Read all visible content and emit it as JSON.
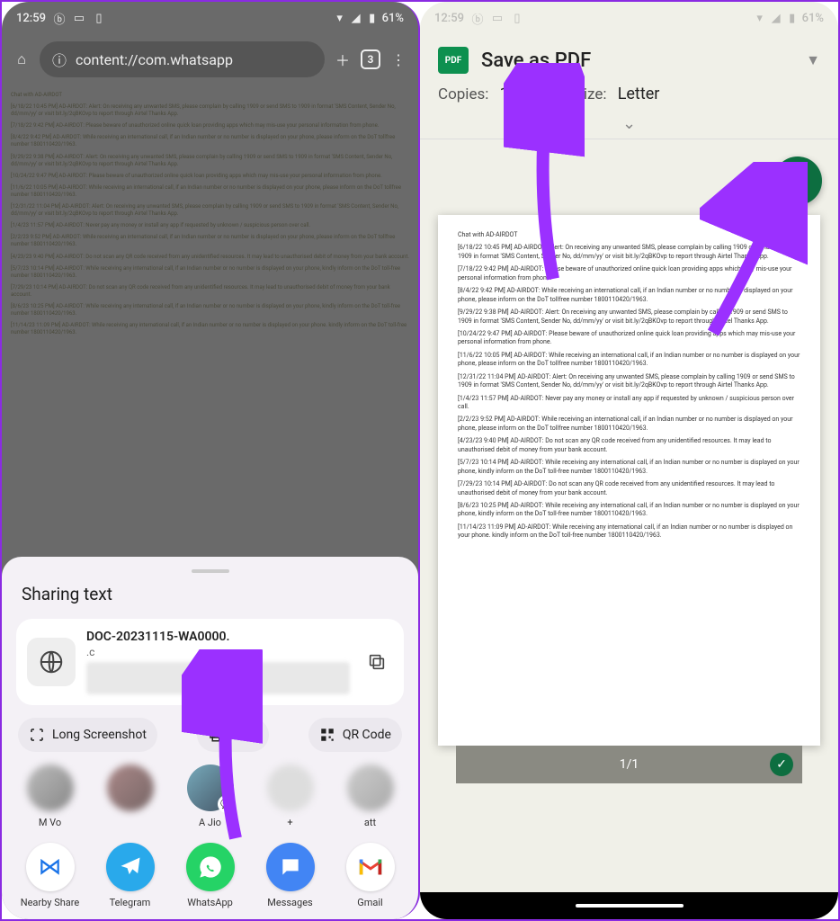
{
  "left": {
    "status": {
      "time": "12:59",
      "battery": "61%"
    },
    "url": "content://com.whatsapp",
    "tab_count": "3",
    "chat_title": "Chat with AD-AIRDOT",
    "chat_lines": [
      "[6/18/22 10:45 PM] AD-AIRDOT: Alert: On receiving any unwanted SMS, please complain by calling 1909 or send SMS to 1909 in format 'SMS Content, Sender No, dd/mm/yy' or visit bit.ly/2qBKOvp to report through Airtel Thanks App.",
      "[7/18/22 9:42 PM] AD-AIRDOT: Please beware of unauthorized online quick loan providing apps which may mis-use your personal information from phone.",
      "[8/4/22 9:42 PM] AD-AIRDOT: While receiving an international call, if an Indian number or no number is displayed on your phone, please inform on the DoT tollfree number 1800110420/1963.",
      "[9/29/22 9:38 PM] AD-AIRDOT: Alert: On receiving any unwanted SMS, please complain by calling 1909 or send SMS to 1909 in format 'SMS Content, Sender No, dd/mm/yy' or visit bit.ly/2qBKOvp to report through Airtel Thanks App.",
      "[10/24/22 9:47 PM] AD-AIRDOT: Please beware of unauthorized online quick loan providing apps which may mis-use your personal information from phone.",
      "[11/6/22 10:05 PM] AD-AIRDOT: While receiving an international call, if an Indian number or no number is displayed on your phone, please inform on the DoT tollfree number 1800110420/1963.",
      "[12/31/22 11:04 PM] AD-AIRDOT: Alert: On receiving any unwanted SMS, please complain by calling 1909 or send SMS to 1909 in format 'SMS Content, Sender No, dd/mm/yy' or visit bit.ly/2qBKOvp to report through Airtel Thanks App.",
      "[1/4/23 11:57 PM] AD-AIRDOT: Never pay any money or install any app if requested by unknown / suspicious person over call.",
      "[2/2/23 9:52 PM] AD-AIRDOT: While receiving an international call, if an Indian number or no number is displayed on your phone, please inform on the DoT tollfree number 1800110420/1963.",
      "[4/23/23 9:40 PM] AD-AIRDOT: Do not scan any QR code received from any unidentified resources. It may lead to unauthorised debit of money from your bank account.",
      "[5/7/23 10:14 PM] AD-AIRDOT: While receiving any international call, if an Indian number or no number is displayed on your phone, kindly inform on the DoT toll-free number 1800110420/1963.",
      "[7/29/23 10:14 PM] AD-AIRDOT: Do not scan any QR code received from any unidentified resources. It may lead to unauthorised debit of money from your bank account.",
      "[8/6/23 10:25 PM] AD-AIRDOT: While receiving any international call, if an Indian number or no number is displayed on your phone, kindly inform on the DoT toll-free number 1800110420/1963.",
      "[11/14/23 11:09 PM] AD-AIRDOT: While receiving any international call, if an Indian number or no number is displayed on your phone. kindly inform on the DoT toll-free number 1800110420/1963."
    ],
    "sheet": {
      "title": "Sharing text",
      "doc": {
        "name": "DOC-20231115-WA0000.",
        "sub": ".c",
        "tail": "·c"
      },
      "actions": {
        "long": "Long Screenshot",
        "print": "Print",
        "qr": "QR Code"
      },
      "contacts": [
        "M Vo",
        "",
        "A Jio",
        "+",
        "att"
      ],
      "apps": {
        "nearby": "Nearby Share",
        "telegram": "Telegram",
        "whatsapp": "WhatsApp",
        "messages": "Messages",
        "gmail": "Gmail"
      }
    }
  },
  "right": {
    "status": {
      "time": "12:59",
      "battery": "61%"
    },
    "destination": "Save as PDF",
    "copies_label": "Copies:",
    "copies_val": "1",
    "paper_label": "Paper size:",
    "paper_val": "Letter",
    "page_counter": "1/1",
    "chat_title": "Chat with AD-AIRDOT",
    "chat_lines": [
      "[6/18/22 10:45 PM] AD-AIRDOT: Alert: On receiving any unwanted SMS, please complain by calling 1909 or send SMS to 1909 in format 'SMS Content, Sender No, dd/mm/yy' or visit bit.ly/2qBKOvp to report through Airtel Thanks App.",
      "[7/18/22 9:42 PM] AD-AIRDOT: Please beware of unauthorized online quick loan providing apps which may mis-use your personal information from phone.",
      "[8/4/22 9:42 PM] AD-AIRDOT: While receiving an international call, if an Indian number or no number is displayed on your phone, please inform on the DoT tollfree number 1800110420/1963.",
      "[9/29/22 9:38 PM] AD-AIRDOT: Alert: On receiving any unwanted SMS, please complain by calling 1909 or send SMS to 1909 in format 'SMS Content, Sender No, dd/mm/yy' or visit bit.ly/2qBKOvp to report through Airtel Thanks App.",
      "[10/24/22 9:47 PM] AD-AIRDOT: Please beware of unauthorized online quick loan providing apps which may mis-use your personal information from phone.",
      "[11/6/22 10:05 PM] AD-AIRDOT: While receiving an international call, if an Indian number or no number is displayed on your phone, please inform on the DoT tollfree number 1800110420/1963.",
      "[12/31/22 11:04 PM] AD-AIRDOT: Alert: On receiving any unwanted SMS, please complain by calling 1909 or send SMS to 1909 in format 'SMS Content, Sender No, dd/mm/yy' or visit bit.ly/2qBKOvp to report through Airtel Thanks App.",
      "[1/4/23 11:57 PM] AD-AIRDOT: Never pay any money or install any app if requested by unknown / suspicious person over call.",
      "[2/2/23 9:52 PM] AD-AIRDOT: While receiving an international call, if an Indian number or no number is displayed on your phone, please inform on the DoT tollfree number 1800110420/1963.",
      "[4/23/23 9:40 PM] AD-AIRDOT: Do not scan any QR code received from any unidentified resources. It may lead to unauthorised debit of money from your bank account.",
      "[5/7/23 10:14 PM] AD-AIRDOT: While receiving any international call, if an Indian number or no number is displayed on your phone, kindly inform on the DoT toll-free number 1800110420/1963.",
      "[7/29/23 10:14 PM] AD-AIRDOT: Do not scan any QR code received from any unidentified resources. It may lead to unauthorised debit of money from your bank account.",
      "[8/6/23 10:25 PM] AD-AIRDOT: While receiving any international call, if an Indian number or no number is displayed on your phone, kindly inform on the DoT toll-free number 1800110420/1963.",
      "[11/14/23 11:09 PM] AD-AIRDOT: While receiving any international call, if an Indian number or no number is displayed on your phone. kindly inform on the DoT toll-free number 1800110420/1963."
    ]
  }
}
